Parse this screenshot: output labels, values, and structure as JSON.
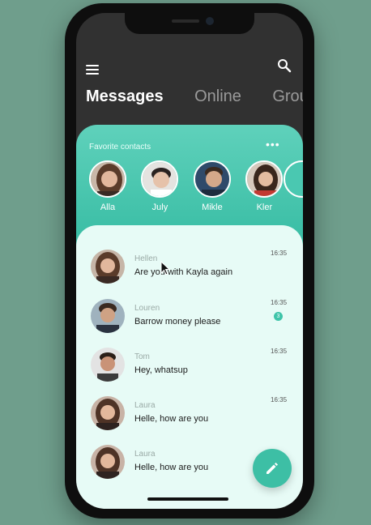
{
  "header": {
    "menu_icon": "menu-icon",
    "search_icon": "search-icon",
    "tabs": [
      {
        "label": "Messages",
        "active": true
      },
      {
        "label": "Online",
        "active": false
      },
      {
        "label": "Grou",
        "active": false
      }
    ]
  },
  "favorites": {
    "title": "Favorite contacts",
    "more_icon": "•••",
    "contacts": [
      {
        "name": "Alla"
      },
      {
        "name": "July"
      },
      {
        "name": "Mikle"
      },
      {
        "name": "Kler"
      }
    ]
  },
  "messages": [
    {
      "name": "Hellen",
      "text": "Are you with Kayla again",
      "time": "16:35"
    },
    {
      "name": "Louren",
      "text": "Barrow money please",
      "time": "16:35",
      "badge": "3"
    },
    {
      "name": "Tom",
      "text": "Hey, whatsup",
      "time": "16:35"
    },
    {
      "name": "Laura",
      "text": "Helle, how are you",
      "time": "16:35"
    },
    {
      "name": "Laura",
      "text": "Helle, how are you",
      "time": ""
    }
  ],
  "colors": {
    "accent": "#3dbfa5",
    "panel": "#e7fbf6",
    "dark": "#313131"
  },
  "fab_icon": "pencil-icon"
}
